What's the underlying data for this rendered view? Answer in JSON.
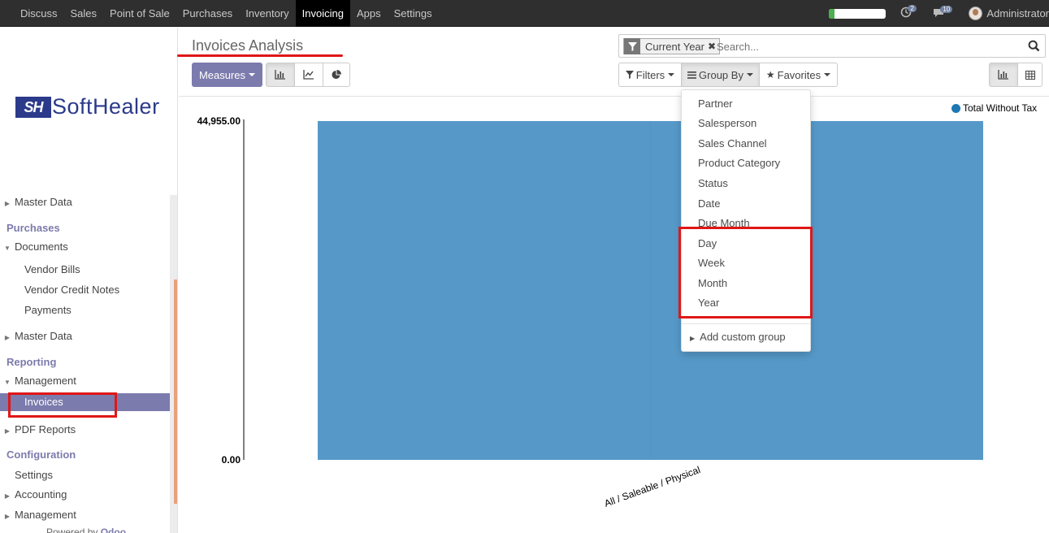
{
  "topbar": {
    "menu": [
      "Discuss",
      "Sales",
      "Point of Sale",
      "Purchases",
      "Inventory",
      "Invoicing",
      "Apps",
      "Settings"
    ],
    "active_menu": "Invoicing",
    "progress_percent": 10,
    "activity_count": "2",
    "message_count": "10",
    "user": "Administrator"
  },
  "sidebar": {
    "logo_mark": "SH",
    "logo_text": "SoftHealer",
    "items": {
      "master_data_1": "Master Data",
      "purchases": "Purchases",
      "documents": "Documents",
      "vendor_bills": "Vendor Bills",
      "vendor_credit_notes": "Vendor Credit Notes",
      "payments": "Payments",
      "master_data_2": "Master Data",
      "reporting": "Reporting",
      "management_1": "Management",
      "invoices": "Invoices",
      "pdf_reports": "PDF Reports",
      "configuration": "Configuration",
      "settings": "Settings",
      "accounting": "Accounting",
      "management_2": "Management"
    },
    "powered_prefix": "Powered by",
    "powered_brand": "Odoo"
  },
  "control": {
    "title": "Invoices Analysis",
    "measures": "Measures",
    "filters": "Filters",
    "group_by": "Group By",
    "favorites": "Favorites",
    "facet_label": "Current Year",
    "search_placeholder": "Search..."
  },
  "dropdown": {
    "items": [
      "Partner",
      "Salesperson",
      "Sales Channel",
      "Product Category",
      "Status",
      "Date",
      "Due Month",
      "Day",
      "Week",
      "Month",
      "Year"
    ],
    "custom": "Add custom group"
  },
  "chart_data": {
    "type": "bar",
    "categories": [
      "All / Saleable / Physical"
    ],
    "series": [
      {
        "name": "Total Without Tax",
        "values": [
          44955.0
        ]
      }
    ],
    "ylim": [
      0,
      44955.0
    ],
    "y_tick_labels": [
      "0.00",
      "44,955.00"
    ],
    "legend_position": "top-right",
    "color": "#5699c9",
    "grid": false
  },
  "colors": {
    "accent": "#7c7bad",
    "topbar": "#2f2f2f",
    "highlight": "#e01717"
  }
}
